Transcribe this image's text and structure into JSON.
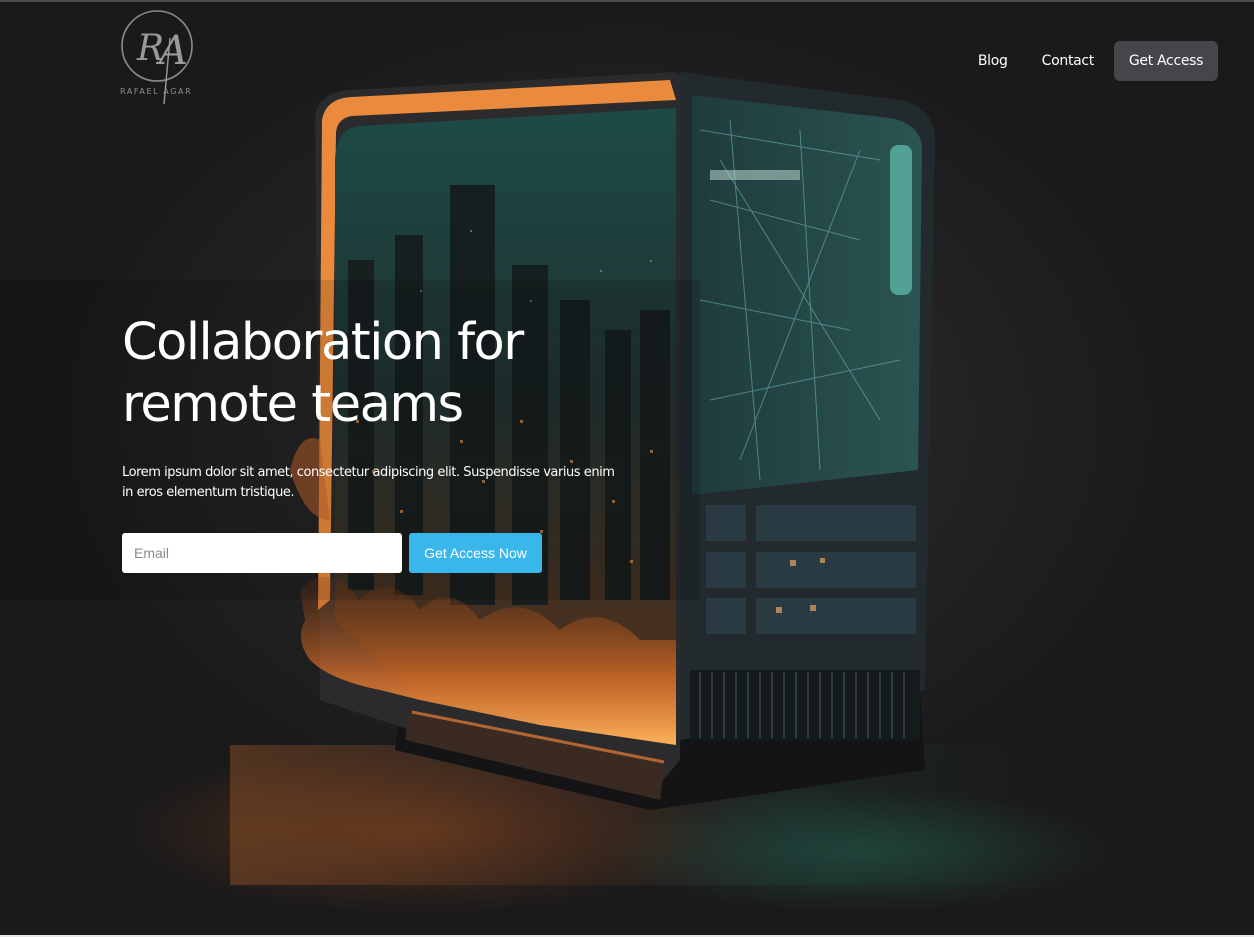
{
  "brand": {
    "monogram": "RA",
    "name": "RAFAEL AGAR"
  },
  "nav": {
    "links": [
      "Blog",
      "Contact"
    ],
    "cta_label": "Get Access"
  },
  "hero": {
    "headline": "Collaboration for remote teams",
    "description": "Lorem ipsum dolor sit amet, consectetur adipiscing elit. Suspendisse varius enim in eros elementum tristique.",
    "email_placeholder": "Email",
    "email_value": "",
    "submit_label": "Get Access Now"
  },
  "colors": {
    "background": "#1e1c1c",
    "cta_blue": "#3ab7ea",
    "nav_button": "#47454a",
    "glow_orange": "#f08a3a",
    "glow_teal": "#39b39a"
  }
}
